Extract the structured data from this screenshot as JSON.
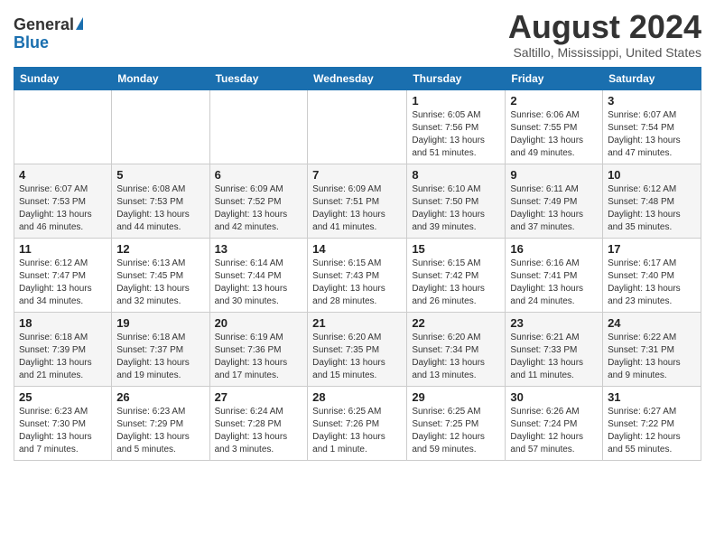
{
  "logo": {
    "general": "General",
    "blue": "Blue"
  },
  "title": "August 2024",
  "subtitle": "Saltillo, Mississippi, United States",
  "headers": [
    "Sunday",
    "Monday",
    "Tuesday",
    "Wednesday",
    "Thursday",
    "Friday",
    "Saturday"
  ],
  "weeks": [
    [
      {
        "day": "",
        "info": ""
      },
      {
        "day": "",
        "info": ""
      },
      {
        "day": "",
        "info": ""
      },
      {
        "day": "",
        "info": ""
      },
      {
        "day": "1",
        "info": "Sunrise: 6:05 AM\nSunset: 7:56 PM\nDaylight: 13 hours\nand 51 minutes."
      },
      {
        "day": "2",
        "info": "Sunrise: 6:06 AM\nSunset: 7:55 PM\nDaylight: 13 hours\nand 49 minutes."
      },
      {
        "day": "3",
        "info": "Sunrise: 6:07 AM\nSunset: 7:54 PM\nDaylight: 13 hours\nand 47 minutes."
      }
    ],
    [
      {
        "day": "4",
        "info": "Sunrise: 6:07 AM\nSunset: 7:53 PM\nDaylight: 13 hours\nand 46 minutes."
      },
      {
        "day": "5",
        "info": "Sunrise: 6:08 AM\nSunset: 7:53 PM\nDaylight: 13 hours\nand 44 minutes."
      },
      {
        "day": "6",
        "info": "Sunrise: 6:09 AM\nSunset: 7:52 PM\nDaylight: 13 hours\nand 42 minutes."
      },
      {
        "day": "7",
        "info": "Sunrise: 6:09 AM\nSunset: 7:51 PM\nDaylight: 13 hours\nand 41 minutes."
      },
      {
        "day": "8",
        "info": "Sunrise: 6:10 AM\nSunset: 7:50 PM\nDaylight: 13 hours\nand 39 minutes."
      },
      {
        "day": "9",
        "info": "Sunrise: 6:11 AM\nSunset: 7:49 PM\nDaylight: 13 hours\nand 37 minutes."
      },
      {
        "day": "10",
        "info": "Sunrise: 6:12 AM\nSunset: 7:48 PM\nDaylight: 13 hours\nand 35 minutes."
      }
    ],
    [
      {
        "day": "11",
        "info": "Sunrise: 6:12 AM\nSunset: 7:47 PM\nDaylight: 13 hours\nand 34 minutes."
      },
      {
        "day": "12",
        "info": "Sunrise: 6:13 AM\nSunset: 7:45 PM\nDaylight: 13 hours\nand 32 minutes."
      },
      {
        "day": "13",
        "info": "Sunrise: 6:14 AM\nSunset: 7:44 PM\nDaylight: 13 hours\nand 30 minutes."
      },
      {
        "day": "14",
        "info": "Sunrise: 6:15 AM\nSunset: 7:43 PM\nDaylight: 13 hours\nand 28 minutes."
      },
      {
        "day": "15",
        "info": "Sunrise: 6:15 AM\nSunset: 7:42 PM\nDaylight: 13 hours\nand 26 minutes."
      },
      {
        "day": "16",
        "info": "Sunrise: 6:16 AM\nSunset: 7:41 PM\nDaylight: 13 hours\nand 24 minutes."
      },
      {
        "day": "17",
        "info": "Sunrise: 6:17 AM\nSunset: 7:40 PM\nDaylight: 13 hours\nand 23 minutes."
      }
    ],
    [
      {
        "day": "18",
        "info": "Sunrise: 6:18 AM\nSunset: 7:39 PM\nDaylight: 13 hours\nand 21 minutes."
      },
      {
        "day": "19",
        "info": "Sunrise: 6:18 AM\nSunset: 7:37 PM\nDaylight: 13 hours\nand 19 minutes."
      },
      {
        "day": "20",
        "info": "Sunrise: 6:19 AM\nSunset: 7:36 PM\nDaylight: 13 hours\nand 17 minutes."
      },
      {
        "day": "21",
        "info": "Sunrise: 6:20 AM\nSunset: 7:35 PM\nDaylight: 13 hours\nand 15 minutes."
      },
      {
        "day": "22",
        "info": "Sunrise: 6:20 AM\nSunset: 7:34 PM\nDaylight: 13 hours\nand 13 minutes."
      },
      {
        "day": "23",
        "info": "Sunrise: 6:21 AM\nSunset: 7:33 PM\nDaylight: 13 hours\nand 11 minutes."
      },
      {
        "day": "24",
        "info": "Sunrise: 6:22 AM\nSunset: 7:31 PM\nDaylight: 13 hours\nand 9 minutes."
      }
    ],
    [
      {
        "day": "25",
        "info": "Sunrise: 6:23 AM\nSunset: 7:30 PM\nDaylight: 13 hours\nand 7 minutes."
      },
      {
        "day": "26",
        "info": "Sunrise: 6:23 AM\nSunset: 7:29 PM\nDaylight: 13 hours\nand 5 minutes."
      },
      {
        "day": "27",
        "info": "Sunrise: 6:24 AM\nSunset: 7:28 PM\nDaylight: 13 hours\nand 3 minutes."
      },
      {
        "day": "28",
        "info": "Sunrise: 6:25 AM\nSunset: 7:26 PM\nDaylight: 13 hours\nand 1 minute."
      },
      {
        "day": "29",
        "info": "Sunrise: 6:25 AM\nSunset: 7:25 PM\nDaylight: 12 hours\nand 59 minutes."
      },
      {
        "day": "30",
        "info": "Sunrise: 6:26 AM\nSunset: 7:24 PM\nDaylight: 12 hours\nand 57 minutes."
      },
      {
        "day": "31",
        "info": "Sunrise: 6:27 AM\nSunset: 7:22 PM\nDaylight: 12 hours\nand 55 minutes."
      }
    ]
  ]
}
